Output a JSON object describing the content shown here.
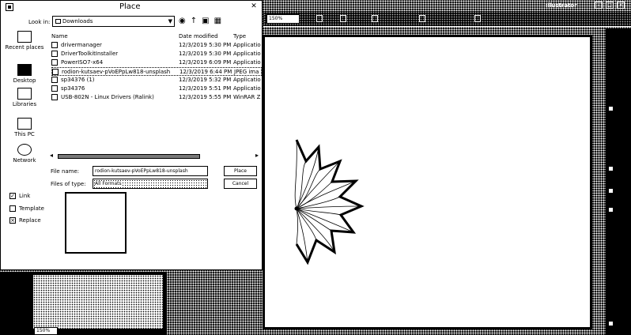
{
  "app": {
    "title": "Illustrator",
    "zoom": "150%",
    "bottom_zoom": "150%"
  },
  "dialog": {
    "title": "Place",
    "close": "✕",
    "look_in_label": "Look in:",
    "look_in_value": "Downloads",
    "places": [
      {
        "label": "Recent places"
      },
      {
        "label": "Desktop"
      },
      {
        "label": "Libraries"
      },
      {
        "label": "This PC"
      },
      {
        "label": "Network"
      }
    ],
    "columns": {
      "name": "Name",
      "date": "Date modified",
      "type": "Type"
    },
    "files": [
      {
        "name": "drivermanager",
        "date": "12/3/2019 5:30 PM",
        "type": "Applicatio"
      },
      {
        "name": "DriverToolkitInstaller",
        "date": "12/3/2019 5:30 PM",
        "type": "Applicatio"
      },
      {
        "name": "PowerISO7-x64",
        "date": "12/3/2019 6:09 PM",
        "type": "Applicatio"
      },
      {
        "name": "rodion-kutsaev-pVoEPpLw818-unsplash",
        "date": "12/3/2019 6:44 PM",
        "type": "JPEG ima"
      },
      {
        "name": "sp34376 (1)",
        "date": "12/3/2019 5:32 PM",
        "type": "Applicatio"
      },
      {
        "name": "sp34376",
        "date": "12/3/2019 5:51 PM",
        "type": "Applicatio"
      },
      {
        "name": "USB-802N - Linux Drivers (Ralink)",
        "date": "12/3/2019 5:55 PM",
        "type": "WinRAR Z"
      }
    ],
    "file_name_label": "File name:",
    "file_name_value": "rodion-kutsaev-pVoEPpLw818-unsplash",
    "file_type_label": "Files of type:",
    "file_type_value": "All Formats",
    "place_button": "Place",
    "cancel_button": "Cancel",
    "options": [
      {
        "label": "Link",
        "checked": true
      },
      {
        "label": "Template",
        "checked": false
      },
      {
        "label": "Replace",
        "checked": false
      }
    ]
  }
}
